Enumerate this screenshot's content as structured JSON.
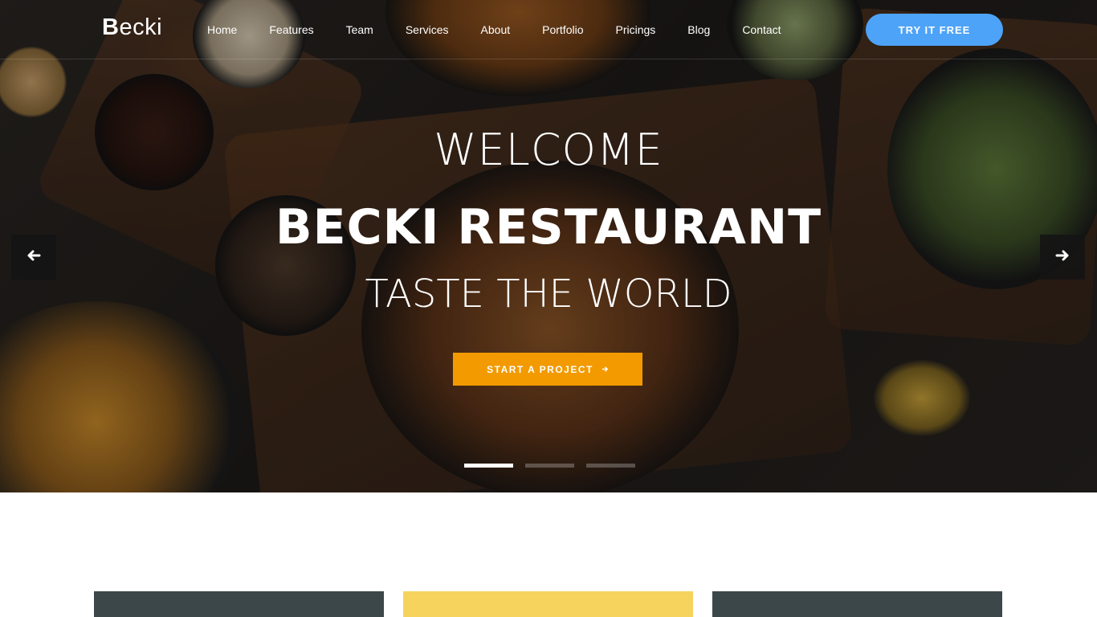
{
  "nav": {
    "logo_first": "B",
    "logo_rest": "ecki",
    "links": [
      "Home",
      "Features",
      "Team",
      "Services",
      "About",
      "Portfolio",
      "Pricings",
      "Blog",
      "Contact"
    ],
    "cta_label": "TRY IT FREE"
  },
  "hero": {
    "welcome": "WELCOME",
    "title": "BECKI RESTAURANT",
    "tagline": "TASTE THE WORLD",
    "button_label": "START A PROJECT",
    "button_icon": "arrow-right-icon",
    "prev_icon": "arrow-left-icon",
    "next_icon": "arrow-right-icon",
    "slides_total": 3,
    "slide_active": 1
  },
  "colors": {
    "cta_blue": "#4da3f7",
    "button_orange": "#f29a00",
    "card_dark": "#3b4748",
    "card_yellow": "#f5d35d"
  }
}
